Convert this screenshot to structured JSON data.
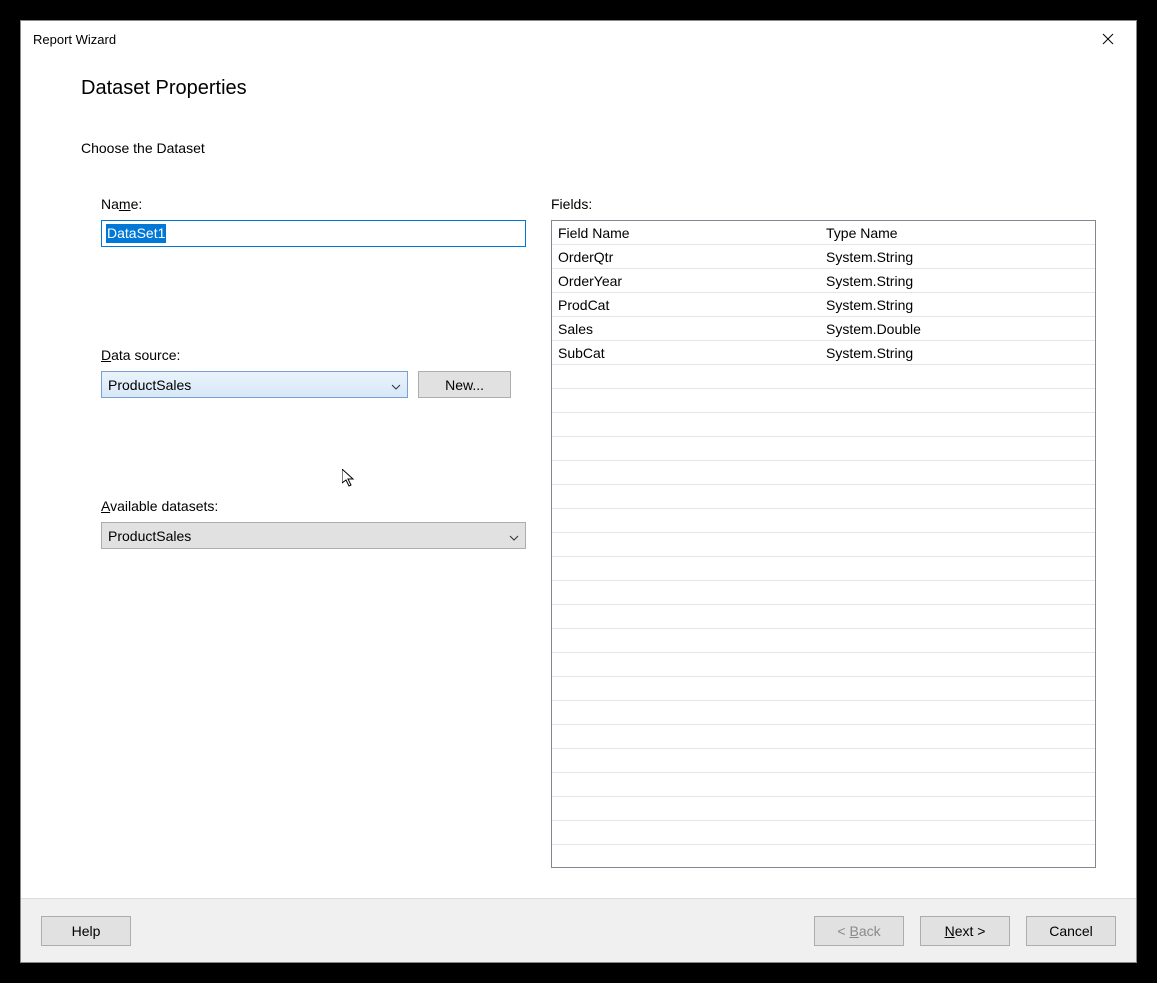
{
  "window": {
    "title": "Report Wizard"
  },
  "page": {
    "heading": "Dataset Properties",
    "subheading": "Choose the Dataset"
  },
  "name": {
    "label_pre": "Na",
    "label_u": "m",
    "label_post": "e:",
    "value": "DataSet1"
  },
  "datasource": {
    "label_u": "D",
    "label_post": "ata source:",
    "selected": "ProductSales",
    "new_button": "New..."
  },
  "available": {
    "label_u": "A",
    "label_post": "vailable datasets:",
    "selected": "ProductSales"
  },
  "fields": {
    "label": "Fields:",
    "header_col1": "Field Name",
    "header_col2": "Type Name",
    "rows": [
      {
        "name": "OrderQtr",
        "type": "System.String"
      },
      {
        "name": "OrderYear",
        "type": "System.String"
      },
      {
        "name": "ProdCat",
        "type": "System.String"
      },
      {
        "name": "Sales",
        "type": "System.Double"
      },
      {
        "name": "SubCat",
        "type": "System.String"
      }
    ]
  },
  "footer": {
    "help": "Help",
    "back_pre": "< ",
    "back_u": "B",
    "back_post": "ack",
    "next_u": "N",
    "next_post": "ext >",
    "cancel": "Cancel"
  }
}
